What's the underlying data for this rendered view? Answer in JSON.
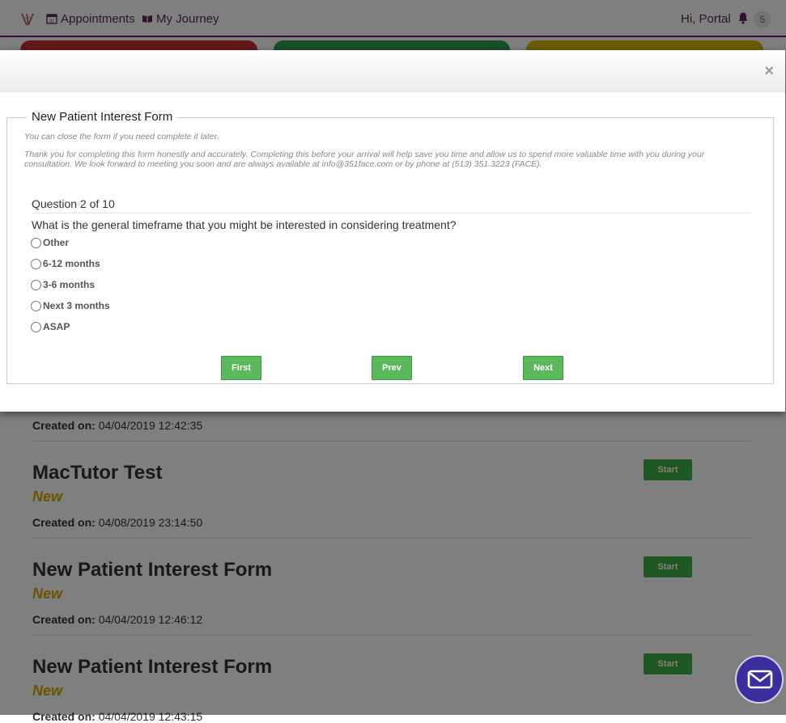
{
  "navbar": {
    "appointments_label": "Appointments",
    "journey_label": "My Journey",
    "greeting": "Hi, Portal",
    "notification_count": "5",
    "colors": {
      "primary": "#5a2a5f",
      "tab_red": "#c9302c",
      "tab_green": "#2e9e4f",
      "tab_yellow": "#d4b800"
    }
  },
  "forms_list": [
    {
      "created_label": "Created on:",
      "created_value": "04/04/2019 12:42:35"
    },
    {
      "title": "MacTutor Test",
      "status": "New",
      "created_label": "Created on:",
      "created_value": "04/08/2019 23:14:50",
      "button": "Start"
    },
    {
      "title": "New Patient Interest Form",
      "status": "New",
      "created_label": "Created on:",
      "created_value": "04/04/2019 12:46:12",
      "button": "Start"
    },
    {
      "title": "New Patient Interest Form",
      "status": "New",
      "created_label": "Created on:",
      "created_value": "04/04/2019 12:43:15",
      "button": "Start"
    }
  ],
  "modal": {
    "close_label": "×",
    "form_title": "New Patient Interest Form",
    "note_close": "You can close the form if you need complete it later.",
    "note_thanks_1": "Thank you for completing this form honestly and accurately. Completing this before your arrival will help save you time and allow us to spend more valuable time with you during your",
    "note_thanks_2": "consultation. We look forward to meeting you soon and are always available at info@351face.com or by phone at (513) 351.3223 (FACE).",
    "question_counter": "Question 2 of 10",
    "question_text": "What is the general timeframe that you might be interested in considering treatment?",
    "options": [
      "Other",
      "6-12 months",
      "3-6 months",
      "Next 3 months",
      "ASAP"
    ],
    "buttons": {
      "first": "First",
      "prev": "Prev",
      "next": "Next"
    }
  },
  "icons": {
    "logo": "brand-logo-icon",
    "calendar": "calendar-icon",
    "book": "book-icon",
    "bell": "bell-icon",
    "message": "envelope-icon"
  }
}
